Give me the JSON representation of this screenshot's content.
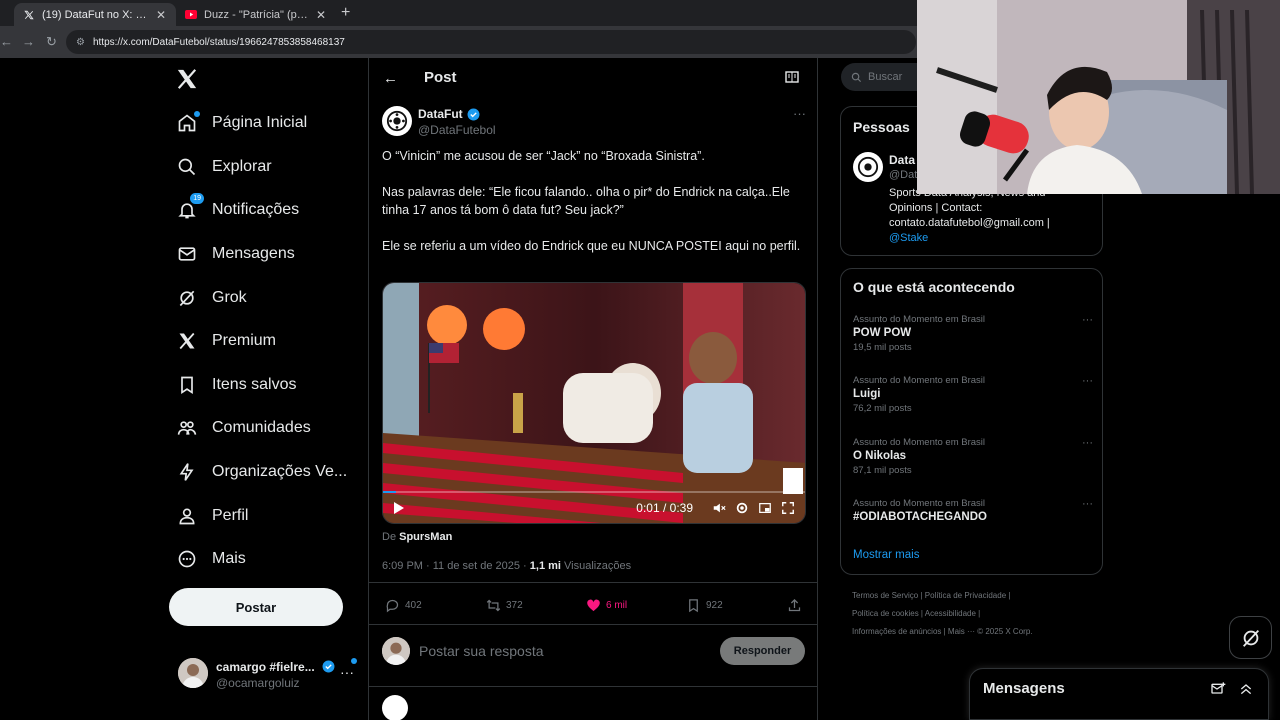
{
  "browser": {
    "tabs": [
      {
        "title": "(19) DataFut no X: \"O \"Vinicin\"",
        "active": true,
        "icon": "x-logo-icon"
      },
      {
        "title": "Duzz - \"Patrícia\" (prod. Sam) (",
        "active": false,
        "icon": "youtube-icon"
      }
    ],
    "url": "https://x.com/DataFutebol/status/1966247853858468137"
  },
  "nav": {
    "items": [
      {
        "label": "Página Inicial",
        "icon": "home-icon"
      },
      {
        "label": "Explorar",
        "icon": "search-icon"
      },
      {
        "label": "Notificações",
        "icon": "bell-icon",
        "badge": "19"
      },
      {
        "label": "Mensagens",
        "icon": "mail-icon"
      },
      {
        "label": "Grok",
        "icon": "grok-icon"
      },
      {
        "label": "Premium",
        "icon": "x-logo-icon"
      },
      {
        "label": "Itens salvos",
        "icon": "bookmark-icon"
      },
      {
        "label": "Comunidades",
        "icon": "people-icon"
      },
      {
        "label": "Organizações Ve...",
        "icon": "lightning-icon"
      },
      {
        "label": "Perfil",
        "icon": "person-icon"
      },
      {
        "label": "Mais",
        "icon": "more-circle-icon"
      }
    ],
    "post_button": "Postar",
    "account": {
      "name": "camargo #fielre...",
      "handle": "@ocamargoluiz"
    }
  },
  "post": {
    "header_title": "Post",
    "author": {
      "name": "DataFut",
      "handle": "@DataFutebol"
    },
    "paragraphs": [
      "O “Vinicin” me acusou de ser “Jack” no “Broxada Sinistra”.",
      "Nas palavras dele: “Ele ficou falando.. olha o pir* do Endrick na calça..Ele tinha 17 anos tá bom ô data fut? Seu jack?”",
      "Ele se referiu a um vídeo do Endrick que eu NUNCA POSTEI aqui no perfil."
    ],
    "video": {
      "time": "0:01 / 0:39",
      "progress": 0.03
    },
    "via_prefix": "De",
    "via_name": "SpursMan",
    "timestamp": "6:09 PM · 11 de set de 2025 ·",
    "views_count": "1,1 mi",
    "views_label": "Visualizações",
    "actions": {
      "replies": "402",
      "reposts": "372",
      "likes": "6 mil",
      "bookmarks": "922"
    },
    "reply_placeholder": "Postar sua resposta",
    "reply_button": "Responder"
  },
  "sidebar": {
    "search_placeholder": "Buscar",
    "people": {
      "title": "Pessoas",
      "name": "Data",
      "handle": "@Dat",
      "bio": "Sports Data Analysis, News and Opinions | Contact: contato.datafutebol@gmail.com |",
      "bio_link": "@Stake"
    },
    "trends_title": "O que está acontecendo",
    "trends": [
      {
        "context": "Assunto do Momento em Brasil",
        "title": "POW POW",
        "count": "19,5 mil posts"
      },
      {
        "context": "Assunto do Momento em Brasil",
        "title": "Luigi",
        "count": "76,2 mil posts"
      },
      {
        "context": "Assunto do Momento em Brasil",
        "title": "O Nikolas",
        "count": "87,1 mil posts"
      },
      {
        "context": "Assunto do Momento em Brasil",
        "title": "#ODIABOTACHEGANDO",
        "count": ""
      }
    ],
    "show_more": "Mostrar mais",
    "footer": [
      "Termos de Serviço  |  Política de Privacidade  |",
      "Política de cookies  |  Acessibilidade  |",
      "Informações de anúncios  |  Mais ···  © 2025 X Corp."
    ]
  },
  "messages_drawer": {
    "title": "Mensagens"
  },
  "colors": {
    "accent": "#1d9bf0",
    "like": "#f91880",
    "background": "#000000"
  }
}
